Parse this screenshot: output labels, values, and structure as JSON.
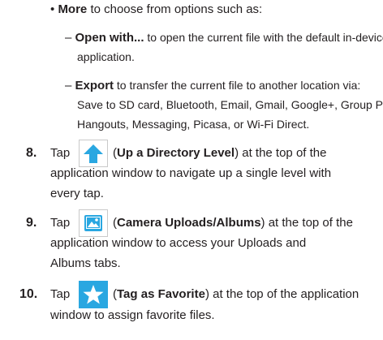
{
  "more_bullet": {
    "bullet": "•",
    "term": "More",
    "rest": " to choose from options such as:"
  },
  "open_with": {
    "dash": "–",
    "term": "Open with...",
    "rest": " to open the current file with the default in-device",
    "rest2": "application."
  },
  "export": {
    "dash": "–",
    "term": "Export",
    "rest": " to transfer the current file to another location via:",
    "line2": "Save to SD card, Bluetooth, Email, Gmail, Google+, Group Play,",
    "line3": "Hangouts, Messaging, Picasa, or Wi-Fi Direct."
  },
  "steps": [
    {
      "number": "8.",
      "tap": "Tap",
      "icon": "up-arrow-icon",
      "open": "(",
      "term": "Up a Directory Level",
      "close": ")",
      "rest": " at the top of the",
      "line2": "application window to navigate up a single level with",
      "line3": "every tap."
    },
    {
      "number": "9.",
      "tap": "Tap",
      "icon": "camera-uploads-albums-icon",
      "open": "(",
      "term": "Camera Uploads/Albums",
      "close": ")",
      "rest": " at the top of the",
      "line2": "application window to access your Uploads and",
      "line3": "Albums tabs."
    },
    {
      "number": "10.",
      "tap": "Tap",
      "icon": "star-icon",
      "open": "(",
      "term": "Tag as Favorite",
      "close": ")",
      "rest": " at the top of the application",
      "line2": "window to assign favorite files."
    }
  ],
  "colors": {
    "text": "#231f20",
    "icon_blue": "#29a7e1",
    "icon_border": "#c9c9c9"
  }
}
